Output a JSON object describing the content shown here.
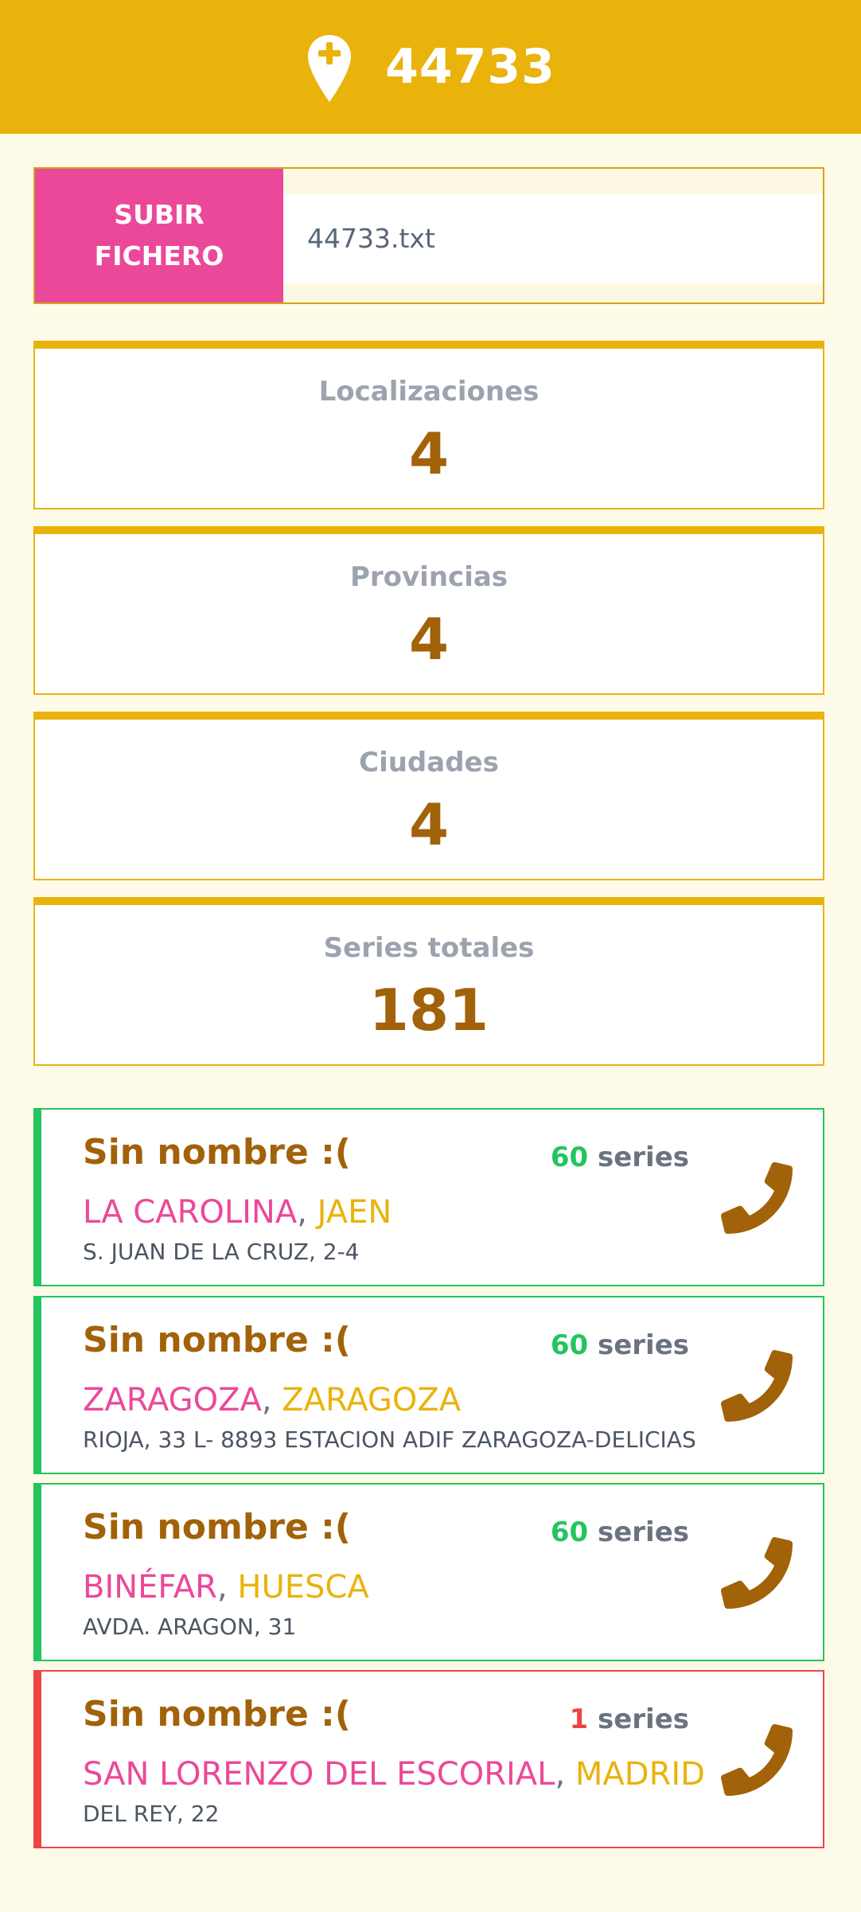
{
  "header": {
    "title": "44733",
    "icon": "map-pin-plus-icon"
  },
  "upload": {
    "button_label": "SUBIR FICHERO",
    "file_name": "44733.txt"
  },
  "stats": [
    {
      "label": "Localizaciones",
      "value": "4"
    },
    {
      "label": "Provincias",
      "value": "4"
    },
    {
      "label": "Ciudades",
      "value": "4"
    },
    {
      "label": "Series totales",
      "value": "181"
    }
  ],
  "locations": [
    {
      "name": "Sin nombre :(",
      "series_count": "60",
      "series_label": "series",
      "city": "LA CAROLINA",
      "separator": ",",
      "province": "JAEN",
      "address": "S. JUAN DE LA CRUZ, 2-4",
      "status": "green",
      "icon": "phone-icon"
    },
    {
      "name": "Sin nombre :(",
      "series_count": "60",
      "series_label": "series",
      "city": "ZARAGOZA",
      "separator": ",",
      "province": "ZARAGOZA",
      "address": "RIOJA, 33 L- 8893 ESTACION ADIF ZARAGOZA-DELICIAS",
      "status": "green",
      "icon": "phone-icon"
    },
    {
      "name": "Sin nombre :(",
      "series_count": "60",
      "series_label": "series",
      "city": "BINÉFAR",
      "separator": ",",
      "province": "HUESCA",
      "address": "AVDA. ARAGON, 31",
      "status": "green",
      "icon": "phone-icon"
    },
    {
      "name": "Sin nombre :(",
      "series_count": "1",
      "series_label": "series",
      "city": "SAN LORENZO DEL ESCORIAL",
      "separator": ",",
      "province": "MADRID",
      "address": "DEL REY, 22",
      "status": "red",
      "icon": "phone-icon"
    }
  ],
  "colors": {
    "header": "#e9b30c",
    "background": "#fefae8",
    "pink": "#ec4899",
    "brown": "#a2620a",
    "green": "#22c55e",
    "red": "#ef4444"
  }
}
